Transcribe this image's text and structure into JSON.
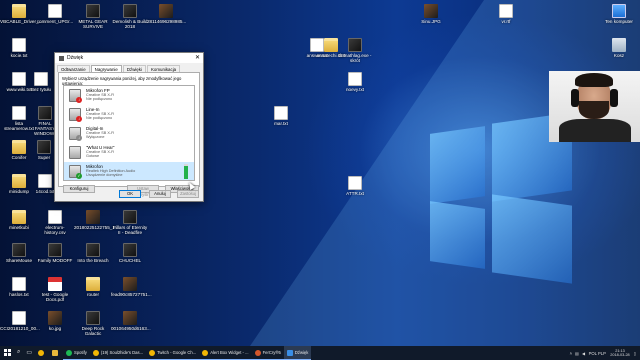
{
  "desktop": {
    "icons": [
      {
        "label": "VBCABLE_Driver_...",
        "type": "folder"
      },
      {
        "label": "comment_UPGr...",
        "type": "doc"
      },
      {
        "label": "METAL GEAR SURVIVE",
        "type": "app"
      },
      {
        "label": "Demolish & Build 2018",
        "type": "app"
      },
      {
        "label": "28114696298985...",
        "type": "img"
      },
      {
        "label": "kocie.txt",
        "type": "doc"
      },
      {
        "label": "www.wiki.txt",
        "type": "doc"
      },
      {
        "label": "Bez tytułu",
        "type": "doc"
      },
      {
        "label": "lista streamerow.txt",
        "type": "doc"
      },
      {
        "label": "FINAL FANTASY WINDOWS",
        "type": "app"
      },
      {
        "label": "Conifer",
        "type": "folder"
      },
      {
        "label": "Super",
        "type": "app"
      },
      {
        "label": "minidump",
        "type": "folder"
      },
      {
        "label": "14cod.txt",
        "type": "doc"
      },
      {
        "label": "minetkubi",
        "type": "folder"
      },
      {
        "label": "electrum-history.csv",
        "type": "doc"
      },
      {
        "label": "20180225122755_1...",
        "type": "img"
      },
      {
        "label": "Pillars of Eternity II - Deadfire",
        "type": "app"
      },
      {
        "label": "ShareMouse",
        "type": "app"
      },
      {
        "label": "Family MODOFF",
        "type": "app"
      },
      {
        "label": "Into the Breach",
        "type": "app"
      },
      {
        "label": "CHUCHEL",
        "type": "app"
      },
      {
        "label": "haslos.txt",
        "type": "doc"
      },
      {
        "label": "test - Google Docs.pdf",
        "type": "pdf"
      },
      {
        "label": "router",
        "type": "folder"
      },
      {
        "label": "fead90c85727751...",
        "type": "img"
      },
      {
        "label": "CCI20181210_00...",
        "type": "doc"
      },
      {
        "label": "ko.jpg",
        "type": "img"
      },
      {
        "label": "Deep Rock Galactic",
        "type": "app"
      },
      {
        "label": "001064950d6163...",
        "type": "img"
      },
      {
        "label": "answer.txt",
        "type": "doc"
      },
      {
        "label": "annatechi.010",
        "type": "folder"
      },
      {
        "label": "demathlag.exe - skrót",
        "type": "app"
      },
      {
        "label": "Sinu.JPG",
        "type": "img"
      },
      {
        "label": "vr.rtf",
        "type": "doc"
      },
      {
        "label": "Ten komputer",
        "type": "pc"
      },
      {
        "label": "Kosz",
        "type": "bin"
      },
      {
        "label": "noevy.txt",
        "type": "doc"
      },
      {
        "label": "mar.txt",
        "type": "doc"
      },
      {
        "label": "ATTR.txt",
        "type": "doc"
      }
    ]
  },
  "dialog": {
    "title": "Dźwięk",
    "close_glyph": "✕",
    "tabs": [
      "Odtwarzanie",
      "Nagrywanie",
      "Dźwięki",
      "Komunikacja"
    ],
    "active_tab": "Nagrywanie",
    "instruction": "Wybierz urządzenie nagrywania poniżej, aby zmodyfikować jego ustawienia:",
    "devices": [
      {
        "name": "Mikrofon FP",
        "driver": "Creative SB X-Fi",
        "status": "Nie podłączono",
        "badge": "err",
        "selected": false
      },
      {
        "name": "Line-In",
        "driver": "Creative SB X-Fi",
        "status": "Nie podłączono",
        "badge": "err",
        "selected": false
      },
      {
        "name": "Digital-In",
        "driver": "Creative SB X-Fi",
        "status": "Wyłączone",
        "badge": "off",
        "selected": false
      },
      {
        "name": "\"What U Hear\"",
        "driver": "Creative SB X-Fi",
        "status": "Gotowe",
        "badge": "none",
        "selected": false
      },
      {
        "name": "Mikrofon",
        "driver": "Realtek High Definition Audio",
        "status": "Urządzenie domyślne",
        "badge": "ok",
        "selected": true,
        "level": 0.9
      }
    ],
    "buttons": {
      "configure": "Konfiguruj",
      "set_default": "Ustaw domyślne",
      "properties": "Właściwości",
      "ok": "OK",
      "cancel": "Anuluj",
      "apply": "Zastosuj"
    }
  },
  "taskbar": {
    "items": [
      {
        "label": "",
        "name": "search",
        "color": "#ffffff"
      },
      {
        "label": "",
        "name": "task-view",
        "color": "#ffffff"
      },
      {
        "label": "",
        "name": "chrome",
        "color": "#f2b705"
      },
      {
        "label": "",
        "name": "explorer",
        "color": "#e9b93b"
      },
      {
        "label": "Spotify",
        "name": "spotify",
        "color": "#1db954"
      },
      {
        "label": "(19) Soul2hide's Das...",
        "name": "chrome-tab",
        "color": "#f2b705"
      },
      {
        "label": "Twitch - Google Ch...",
        "name": "twitch",
        "color": "#9146ff"
      },
      {
        "label": "Alert Box Widget - ...",
        "name": "alert",
        "color": "#31c3a2"
      },
      {
        "label": "FerCry®5",
        "name": "farcry",
        "color": "#d4572c"
      },
      {
        "label": "Dźwięk",
        "name": "sound",
        "color": "#3a8ee6"
      }
    ],
    "tray": {
      "lang": "POL PLP",
      "time": "21:13",
      "date": "2018-03-28"
    }
  }
}
